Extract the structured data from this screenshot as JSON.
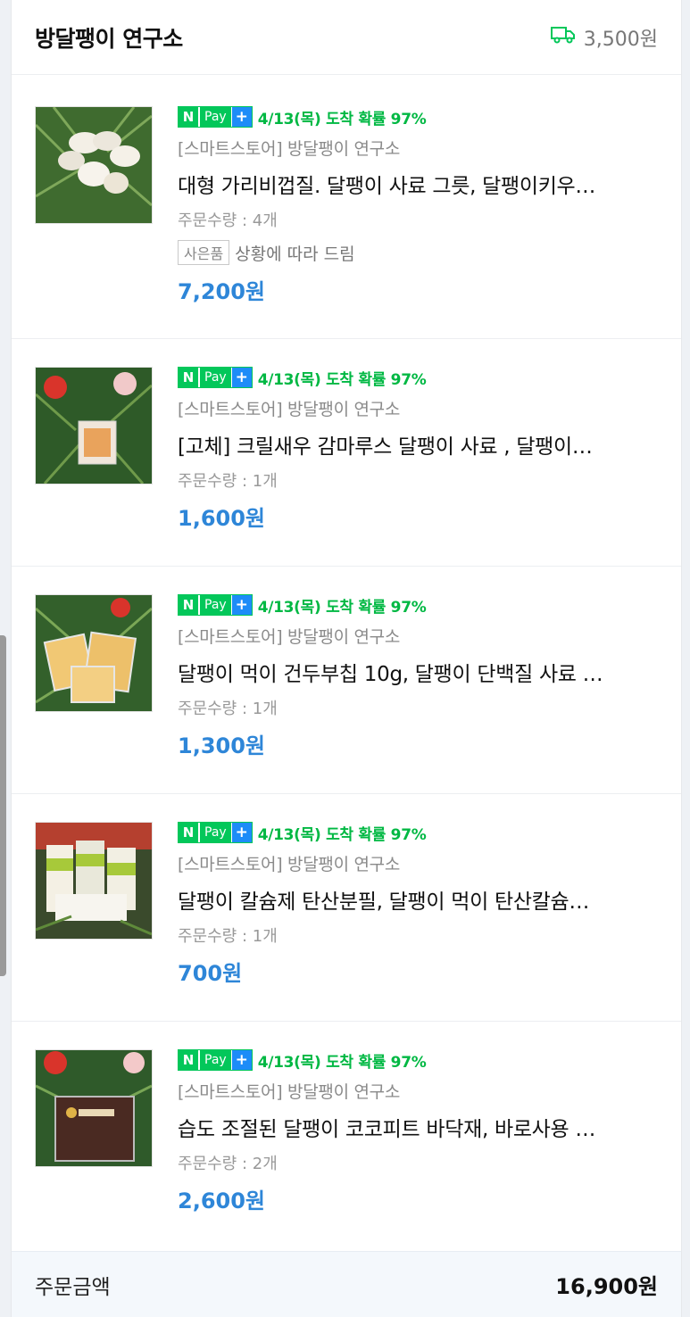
{
  "store": {
    "name": "방달팽이 연구소",
    "shipping_fee": "3,500원",
    "shipping_icon": "delivery-truck-icon"
  },
  "badge": {
    "n": "N",
    "pay": "Pay",
    "plus": "+"
  },
  "items": [
    {
      "arrival": "4/13(목) 도착 확률 97%",
      "seller": "[스마트스토어] 방달팽이 연구소",
      "title": "대형 가리비껍질. 달팽이 사료 그릇, 달팽이키우…",
      "qty": "주문수량 : 4개",
      "gift_tag": "사은품",
      "gift_text": "상황에 따라 드림",
      "price": "7,200원"
    },
    {
      "arrival": "4/13(목) 도착 확률 97%",
      "seller": "[스마트스토어] 방달팽이 연구소",
      "title": "[고체] 크릴새우 감마루스 달팽이 사료 , 달팽이…",
      "qty": "주문수량 : 1개",
      "price": "1,600원"
    },
    {
      "arrival": "4/13(목) 도착 확률 97%",
      "seller": "[스마트스토어] 방달팽이 연구소",
      "title": "달팽이 먹이 건두부칩 10g, 달팽이 단백질 사료 …",
      "qty": "주문수량 : 1개",
      "price": "1,300원"
    },
    {
      "arrival": "4/13(목) 도착 확률 97%",
      "seller": "[스마트스토어] 방달팽이 연구소",
      "title": "달팽이 칼슘제 탄산분필, 달팽이 먹이 탄산칼슘…",
      "qty": "주문수량 : 1개",
      "price": "700원"
    },
    {
      "arrival": "4/13(목) 도착 확률 97%",
      "seller": "[스마트스토어] 방달팽이 연구소",
      "title": "습도 조절된 달팽이 코코피트 바닥재, 바로사용 …",
      "qty": "주문수량 : 2개",
      "price": "2,600원"
    }
  ],
  "footer": {
    "label": "주문금액",
    "total": "16,900원"
  },
  "colors": {
    "npay_green": "#03c75a",
    "arrival_green": "#00b843",
    "price_blue": "#2e86d8"
  }
}
